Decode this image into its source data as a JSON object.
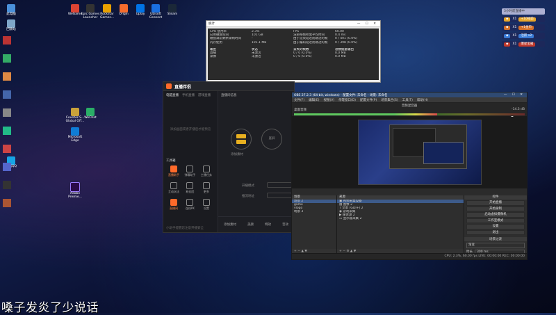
{
  "subtitle": "嗓子发炎了少说话",
  "desktop_icons_left": [
    {
      "label": "WeGame",
      "color": "#d43"
    },
    {
      "label": "Epic Games Launcher",
      "color": "#333"
    },
    {
      "label": "Rockstar Games...",
      "color": "#e8a000"
    },
    {
      "label": "Origin",
      "color": "#f56c2d"
    },
    {
      "label": "Uplay",
      "color": "#0073e6"
    },
    {
      "label": "Ubisoft Connect",
      "color": "#1a6fe0"
    },
    {
      "label": "Steam",
      "color": "#1b2838"
    },
    {
      "label": "Counter-S... Global Off...",
      "color": "#caa23a"
    },
    {
      "label": "WeChat",
      "color": "#2aae67"
    },
    {
      "label": "Microsoft Edge",
      "color": "#0f7cd6"
    },
    {
      "label": "腾讯QQ",
      "color": "#17a4e4"
    },
    {
      "label": "此电脑",
      "color": "#4a90d9"
    },
    {
      "label": "回收站",
      "color": "#7fa7c9"
    },
    {
      "label": "Adobe Premie...",
      "color": "#2a0a4a"
    }
  ],
  "noti": {
    "header": "3小时前直播中",
    "items": [
      {
        "tag": "+10经验",
        "tag_color": "#e8a72a",
        "label": "X1"
      },
      {
        "tag": "+1金币",
        "tag_color": "#d4702a",
        "label": "X1"
      },
      {
        "tag": "活跃 x2",
        "tag_color": "#3a7bd5",
        "label": "X1"
      },
      {
        "tag": "爆星宝箱",
        "tag_color": "#c0392b",
        "label": "X1"
      }
    ]
  },
  "stats": {
    "title": "统计",
    "rows": [
      [
        "CPU 使用率",
        "2.3%",
        "FPS",
        "60.00"
      ],
      [
        "已用磁盘空间",
        "101 GB",
        "渲染每帧所需平均时间",
        "0.4 ms"
      ],
      [
        "磁盘满前剩余录制时间",
        "-",
        "由于渲染延迟而跳过的帧",
        "0 / 401 (0.0%)"
      ],
      [
        "内存使用",
        "191.1 MB",
        "由于编码延迟而跳过的帧",
        "0 / 398 (0.0%)"
      ],
      [
        "",
        "",
        "",
        ""
      ],
      [
        "输出",
        "状态",
        "丢失的帧数",
        "总数据量输出"
      ],
      [
        "直播",
        "未激活",
        "0 / 0 (0.0%)",
        "0.0 MB"
      ],
      [
        "录像",
        "未激活",
        "0 / 0 (0.0%)",
        "0.0 MB"
      ]
    ]
  },
  "streamer": {
    "logo": "直播伴侣",
    "tabs": [
      "电脑直播",
      "手机直播",
      "游戏直播"
    ],
    "placeholder": "添加画面或者开播后才能预览",
    "toolbox_title": "工具箱",
    "tools": [
      "直播助手",
      "弹幕助手",
      "主播任务",
      "互动玩法",
      "粉丝团",
      "更多",
      "直播间",
      "连线PK",
      "设置"
    ],
    "topbar": [
      "设置",
      "直播间信息",
      "开始直播"
    ],
    "mode_left": "横屏",
    "mode_right": "竖屏",
    "source_text": "添加素材",
    "mode_label": "开播模式",
    "cast_label": "推流地址",
    "footer_items": [
      "添加素材",
      "美颜",
      "特效",
      "音效",
      "开播"
    ],
    "bottom_notice": "小助手提醒您注意开播安全"
  },
  "obs": {
    "title": "OBS 27.2.3 (64-bit, windows) - 配置文件: 未命名 - 场景: 未命名",
    "menus": [
      "文件(F)",
      "编辑(E)",
      "视图(V)",
      "停靠窗口(D)",
      "配置文件(P)",
      "场景集合(S)",
      "工具(T)",
      "帮助(H)"
    ],
    "audio_header": "音频混音器",
    "audio_channels": [
      {
        "label": "桌面音频",
        "db": "-14.3 dB",
        "level": 0.62
      },
      {
        "label": "麦克风/Aux",
        "db": "-∞",
        "level": 0.0
      }
    ],
    "scenes_header": "场景",
    "scenes": [
      "场景 2",
      "game",
      "vlogo",
      "场景 3"
    ],
    "sources_header": "来源",
    "sources": [
      "视频采集设备",
      "图像 2",
      "文本 (GDI+) 2",
      "游戏采集",
      "媒体源 2",
      "显示器采集 2"
    ],
    "filters_header": "转场动画",
    "filter_tab": "混音器",
    "controls_header": "控件",
    "controls": [
      "开始直播",
      "开始录制",
      "启动虚拟摄像机",
      "工作室模式",
      "设置",
      "退出"
    ],
    "transition_header": "场景过渡",
    "transition_value": "渐变",
    "duration_label": "时长",
    "duration_value": "300 ms",
    "status": "CPU: 2.3%, 60.00 fps   LIVE: 00:00:00   REC: 00:00:00"
  }
}
